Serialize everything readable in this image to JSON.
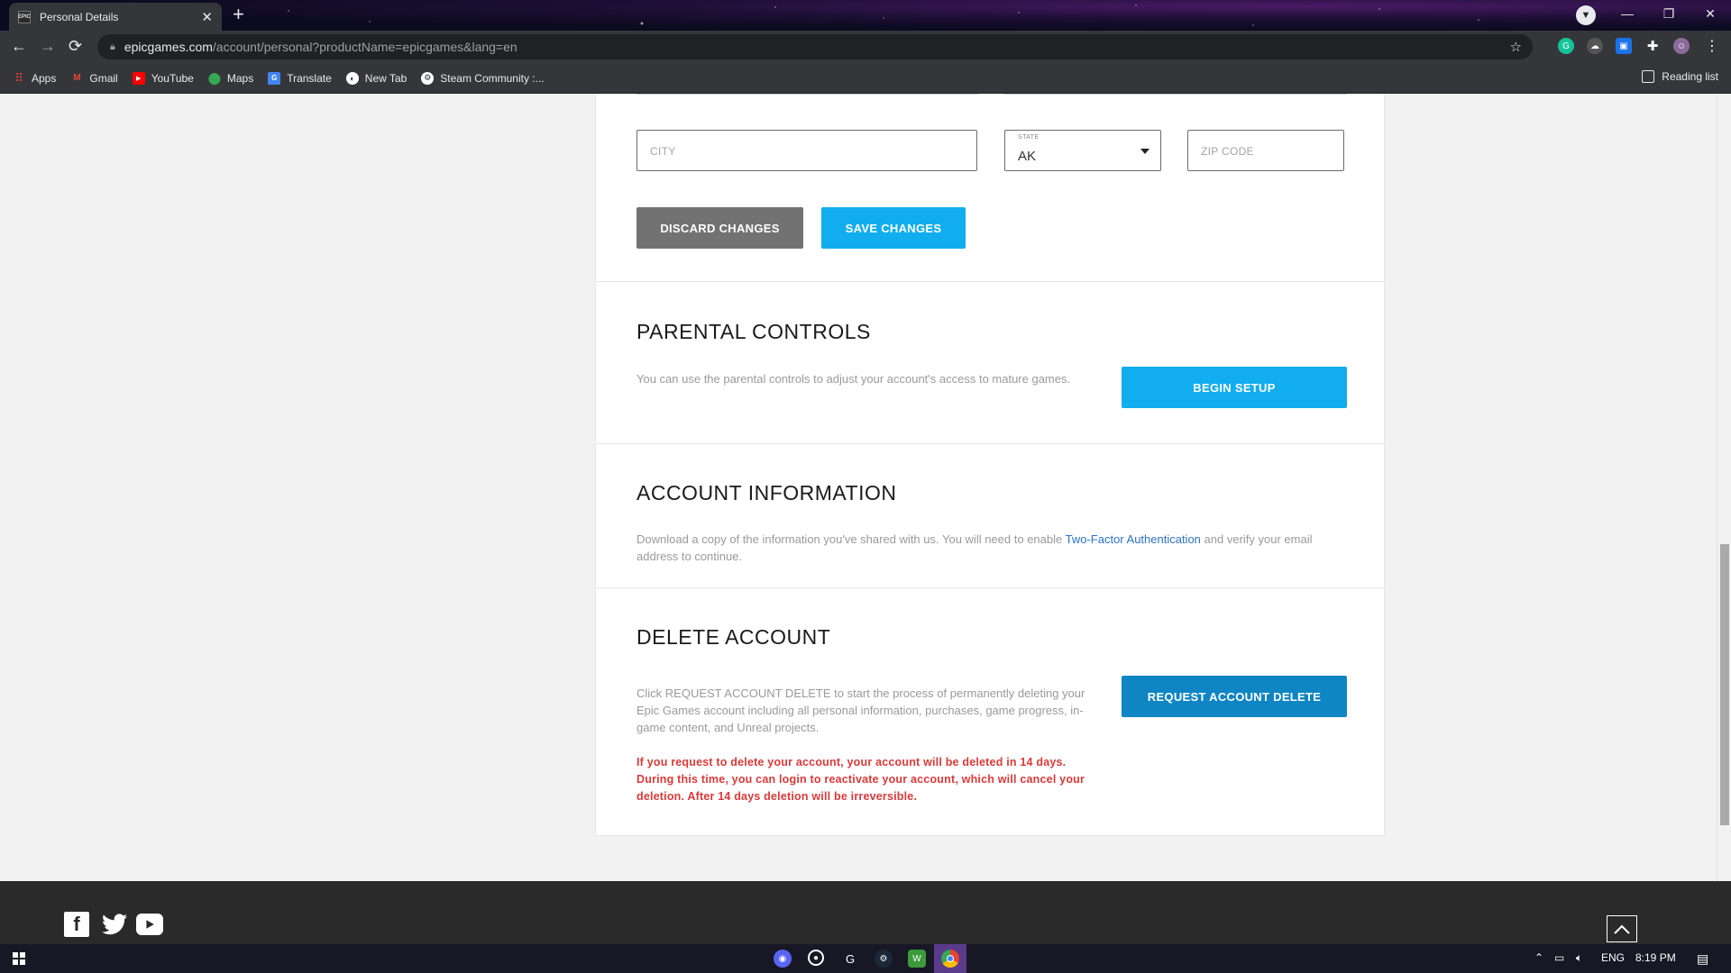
{
  "browser": {
    "tab_title": "Personal Details",
    "tab_favicon": "EPIC",
    "new_tab_symbol": "+",
    "url_host": "epicgames.com",
    "url_path": "/account/personal?productName=epicgames&lang=en",
    "window_controls": {
      "minimize": "—",
      "restore": "❐",
      "close": "✕"
    },
    "reading_list": "Reading list"
  },
  "bookmarks": [
    {
      "label": "Apps",
      "icon": "apps-grid-icon",
      "color": "#ea4335"
    },
    {
      "label": "Gmail",
      "icon": "gmail-icon",
      "color": "#ea4335"
    },
    {
      "label": "YouTube",
      "icon": "youtube-icon",
      "color": "#ff0000"
    },
    {
      "label": "Maps",
      "icon": "maps-icon",
      "color": "#34a853"
    },
    {
      "label": "Translate",
      "icon": "translate-icon",
      "color": "#4285f4"
    },
    {
      "label": "New Tab",
      "icon": "new-tab-icon",
      "color": "#ffffff"
    },
    {
      "label": "Steam Community :...",
      "icon": "steam-icon",
      "color": "#1b2838"
    }
  ],
  "address": {
    "city_placeholder": "CITY",
    "state_label": "STATE",
    "state_value": "AK",
    "zip_placeholder": "ZIP CODE",
    "discard_label": "DISCARD CHANGES",
    "save_label": "SAVE CHANGES"
  },
  "parental": {
    "title": "PARENTAL CONTROLS",
    "description": "You can use the parental controls to adjust your account's access to mature games.",
    "button": "BEGIN SETUP"
  },
  "account_info": {
    "title": "ACCOUNT INFORMATION",
    "text_before": "Download a copy of the information you've shared with us. You will need to enable ",
    "link": "Two-Factor Authentication",
    "text_after": " and verify your email address to continue."
  },
  "delete_account": {
    "title": "DELETE ACCOUNT",
    "description": "Click REQUEST ACCOUNT DELETE to start the process of permanently deleting your Epic Games account including all personal information, purchases, game progress, in-game content, and Unreal projects.",
    "warning": "If you request to delete your account, your account will be deleted in 14 days. During this time, you can login to reactivate your account, which will cancel your deletion. After 14 days deletion will be irreversible.",
    "button": "REQUEST ACCOUNT DELETE"
  },
  "taskbar": {
    "language": "ENG",
    "time": "8:19 PM"
  },
  "colors": {
    "accent_blue": "#11adee",
    "delete_blue": "#0f85c4",
    "discard_gray": "#727272",
    "warning_red": "#d93a3a"
  }
}
